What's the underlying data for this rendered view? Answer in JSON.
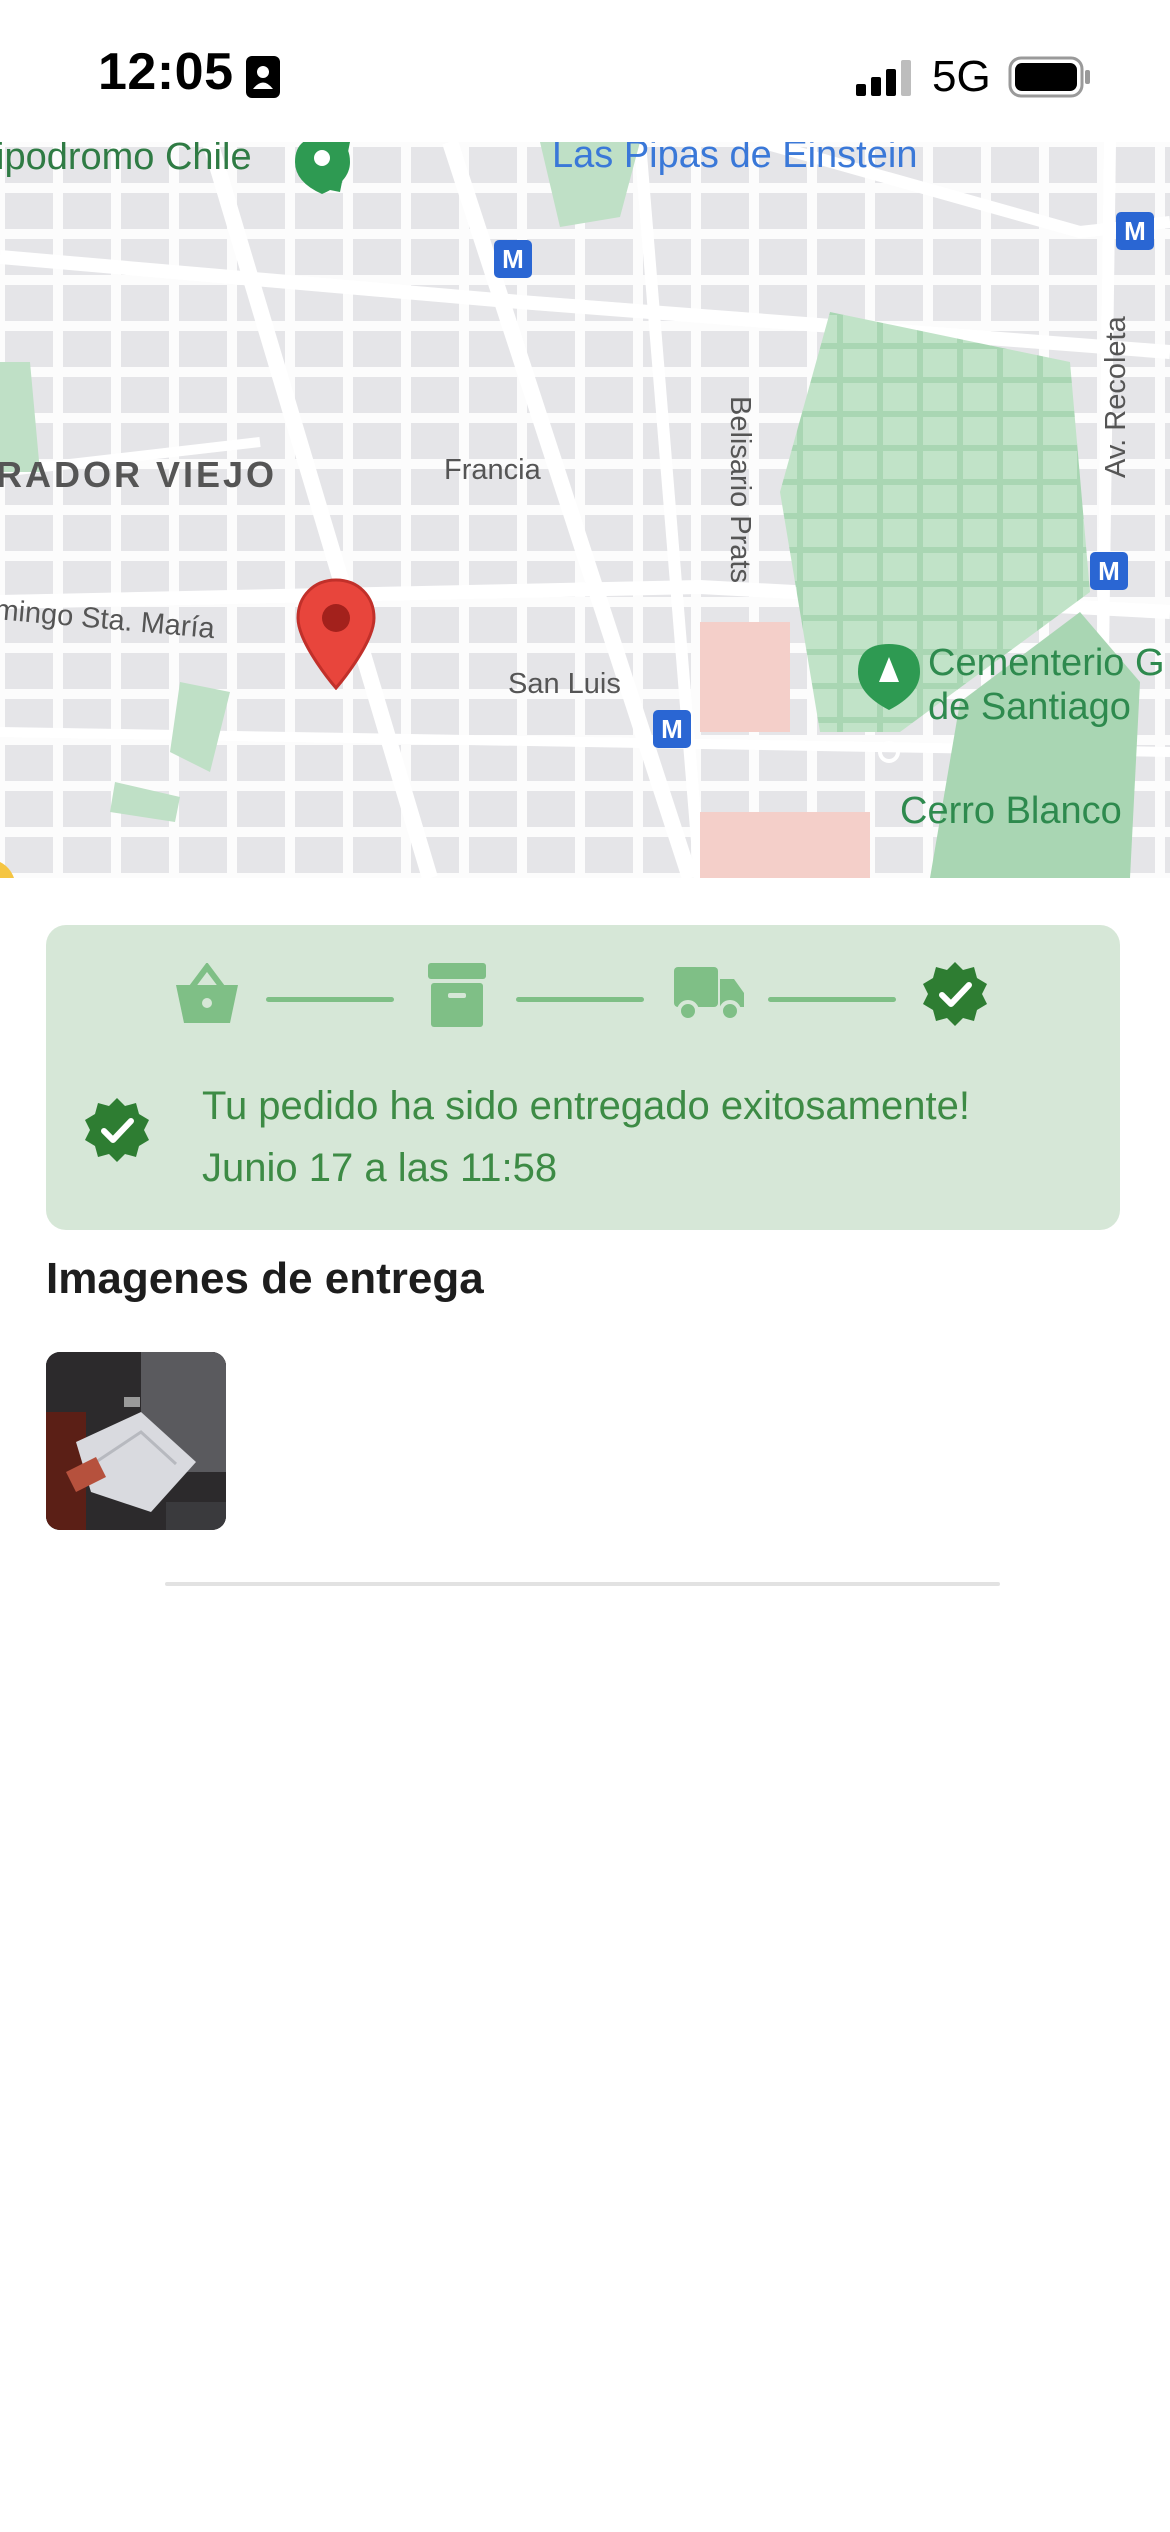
{
  "status_bar": {
    "time": "12:05",
    "network": "5G",
    "icons": [
      "contact-card-icon",
      "signal-bars-icon",
      "battery-icon"
    ]
  },
  "map": {
    "labels": {
      "hipodromo": "ipodromo Chile",
      "pipas": "Las Pipas de Einstein",
      "recoleta": "Av. Recoleta",
      "mirador": "RADOR VIEJO",
      "francia": "Francia",
      "belisario": "Belisario Prats",
      "domingo": "mingo Sta. María",
      "san_luis": "San Luis",
      "cementerio_1": "Cementerio G",
      "cementerio_2": "de Santiago",
      "cerro_blanco": "Cerro Blanco"
    },
    "metro_badge": "M",
    "colors": {
      "pin": "#e8453c",
      "park": "#bfe0c6",
      "metro": "#2a66d3"
    }
  },
  "delivery": {
    "steps": [
      "basket-icon",
      "box-icon",
      "truck-icon",
      "check-badge-icon"
    ],
    "message": "Tu pedido ha sido entregado exitosamente!",
    "date": "Junio 17 a las 11:58",
    "colors": {
      "card": "#d6e7d7",
      "text": "#3d8b45",
      "accent": "#2e7d32"
    }
  },
  "images": {
    "title": "Imagenes de entrega"
  }
}
